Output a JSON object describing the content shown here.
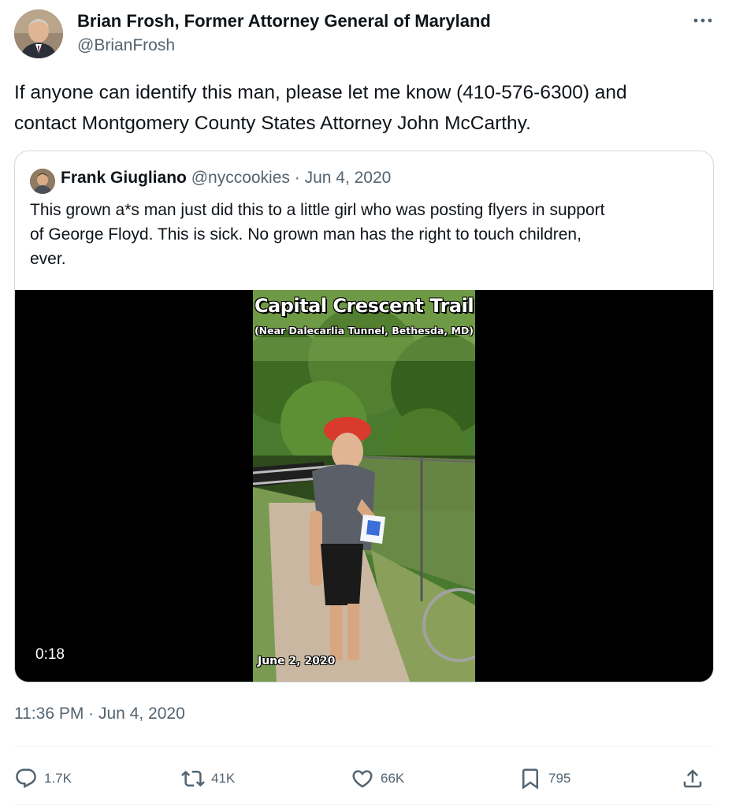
{
  "tweet": {
    "author": {
      "name": "Brian Frosh, Former Attorney General of Maryland",
      "handle": "@BrianFrosh"
    },
    "more_icon": "ellipsis-icon",
    "text_line1": "If anyone can identify this man, please let me know (410-576-6300) and",
    "text_line2": "contact Montgomery County States Attorney John McCarthy.",
    "timestamp": "11:36 PM · Jun 4, 2020"
  },
  "quote": {
    "name": "Frank Giugliano",
    "meta": "@nyccookies · Jun 4, 2020",
    "text_line1": "This grown a*s man just did this to a little girl who was posting flyers in support",
    "text_line2": "of George Floyd. This is sick. No grown man has the right to touch children,",
    "text_line3": "ever.",
    "video": {
      "title": "Capital Crescent Trail",
      "subtitle": "(Near Dalecarlia Tunnel, Bethesda, MD)",
      "date_overlay": "June 2, 2020",
      "duration": "0:18"
    }
  },
  "actions": {
    "reply": {
      "icon": "reply-icon",
      "count": "1.7K"
    },
    "retweet": {
      "icon": "retweet-icon",
      "count": "41K"
    },
    "like": {
      "icon": "heart-icon",
      "count": "66K"
    },
    "bookmark": {
      "icon": "bookmark-icon",
      "count": "795"
    },
    "share": {
      "icon": "share-icon"
    }
  },
  "colors": {
    "text": "#0f1419",
    "secondary": "#536471",
    "border": "#cfd9de"
  }
}
